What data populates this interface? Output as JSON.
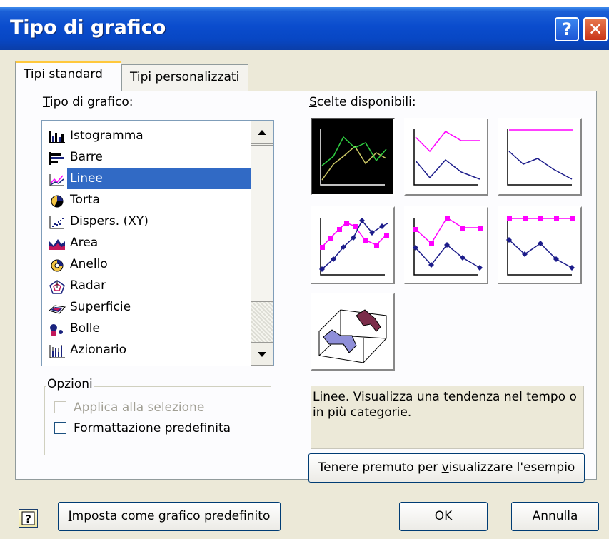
{
  "window": {
    "title": "Tipo di grafico",
    "help_glyph": "?",
    "close_glyph": "✕"
  },
  "tabs": [
    {
      "label": "Tipi standard",
      "active": true
    },
    {
      "label": "Tipi personalizzati",
      "active": false
    }
  ],
  "chart_types": {
    "label_prefix": "T",
    "label_rest": "ipo di grafico:",
    "items": [
      {
        "label": "Istogramma",
        "icon": "column-chart-icon"
      },
      {
        "label": "Barre",
        "icon": "bar-chart-icon"
      },
      {
        "label": "Linee",
        "icon": "line-chart-icon",
        "selected": true
      },
      {
        "label": "Torta",
        "icon": "pie-chart-icon"
      },
      {
        "label": "Dispers. (XY)",
        "icon": "scatter-chart-icon"
      },
      {
        "label": "Area",
        "icon": "area-chart-icon"
      },
      {
        "label": "Anello",
        "icon": "doughnut-chart-icon"
      },
      {
        "label": "Radar",
        "icon": "radar-chart-icon"
      },
      {
        "label": "Superficie",
        "icon": "surface-chart-icon"
      },
      {
        "label": "Bolle",
        "icon": "bubble-chart-icon"
      },
      {
        "label": "Azionario",
        "icon": "stock-chart-icon"
      }
    ]
  },
  "options": {
    "legend": "Opzioni",
    "apply_to_selection": {
      "label": "Applica alla selezione",
      "checked": false,
      "enabled": false
    },
    "default_formatting": {
      "prefix": "F",
      "rest": "ormattazione predefinita",
      "checked": false,
      "enabled": true
    }
  },
  "subtypes": {
    "label_prefix": "S",
    "label_rest": "celte disponibili:",
    "items": [
      {
        "name": "line-subtype",
        "selected": true
      },
      {
        "name": "stacked-line-subtype"
      },
      {
        "name": "100-percent-stacked-line-subtype"
      },
      {
        "name": "line-with-markers-subtype"
      },
      {
        "name": "stacked-line-with-markers-subtype"
      },
      {
        "name": "100-percent-stacked-line-with-markers-subtype"
      },
      {
        "name": "3d-line-subtype"
      }
    ]
  },
  "description": "Linee. Visualizza una tendenza nel tempo o in più categorie.",
  "preview_button": {
    "before": "Tenere premuto per ",
    "underlined": "v",
    "after": "isualizzare l'esempio"
  },
  "footer": {
    "set_default": {
      "prefix": "I",
      "rest": "mposta come grafico predefinito"
    },
    "ok": "OK",
    "cancel": "Annulla"
  },
  "colors": {
    "title_bar": "#0a4ccd",
    "selection": "#316ac5",
    "dialog_face": "#ece9d8",
    "series_magenta": "#ff00ff",
    "series_navy": "#1c1c8a"
  }
}
